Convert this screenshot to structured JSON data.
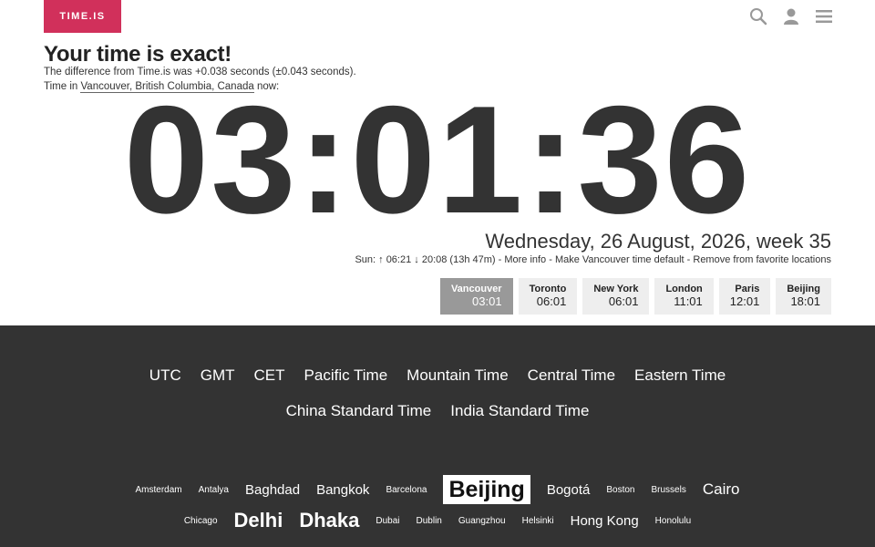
{
  "header": {
    "logo": "TIME.IS",
    "icons": [
      "search-icon",
      "user-icon",
      "menu-icon"
    ]
  },
  "status": {
    "headline": "Your time is exact!",
    "difference": "The difference from Time.is was +0.038 seconds (±0.043 seconds).",
    "location_prefix": "Time in ",
    "location": "Vancouver, British Columbia, Canada",
    "location_suffix": " now:"
  },
  "clock": {
    "time": "03:01:36"
  },
  "date": {
    "full": "Wednesday, 26 August, 2026, week 35",
    "sun_line": "Sun: ↑ 06:21 ↓ 20:08 (13h 47m) - More info - Make Vancouver time default - Remove from favorite locations"
  },
  "favorites": [
    {
      "city": "Vancouver",
      "time": "03:01",
      "active": true
    },
    {
      "city": "Toronto",
      "time": "06:01",
      "active": false
    },
    {
      "city": "New York",
      "time": "06:01",
      "active": false
    },
    {
      "city": "London",
      "time": "11:01",
      "active": false
    },
    {
      "city": "Paris",
      "time": "12:01",
      "active": false
    },
    {
      "city": "Beijing",
      "time": "18:01",
      "active": false
    }
  ],
  "zones": {
    "row1": [
      "UTC",
      "GMT",
      "CET",
      "Pacific Time",
      "Mountain Time",
      "Central Time",
      "Eastern Time"
    ],
    "row2": [
      "China Standard Time",
      "India Standard Time"
    ]
  },
  "cities": {
    "row1": [
      "Amsterdam",
      "Antalya",
      "Baghdad",
      "Bangkok",
      "Barcelona",
      "Beijing",
      "Bogotá",
      "Boston",
      "Brussels",
      "Cairo"
    ],
    "row2": [
      "Chicago",
      "Delhi",
      "Dhaka",
      "Dubai",
      "Dublin",
      "Guangzhou",
      "Helsinki",
      "Hong Kong",
      "Honolulu"
    ]
  },
  "colors": {
    "brand": "#d1305b",
    "dark_bg": "#333333",
    "active_fav": "#999999"
  }
}
